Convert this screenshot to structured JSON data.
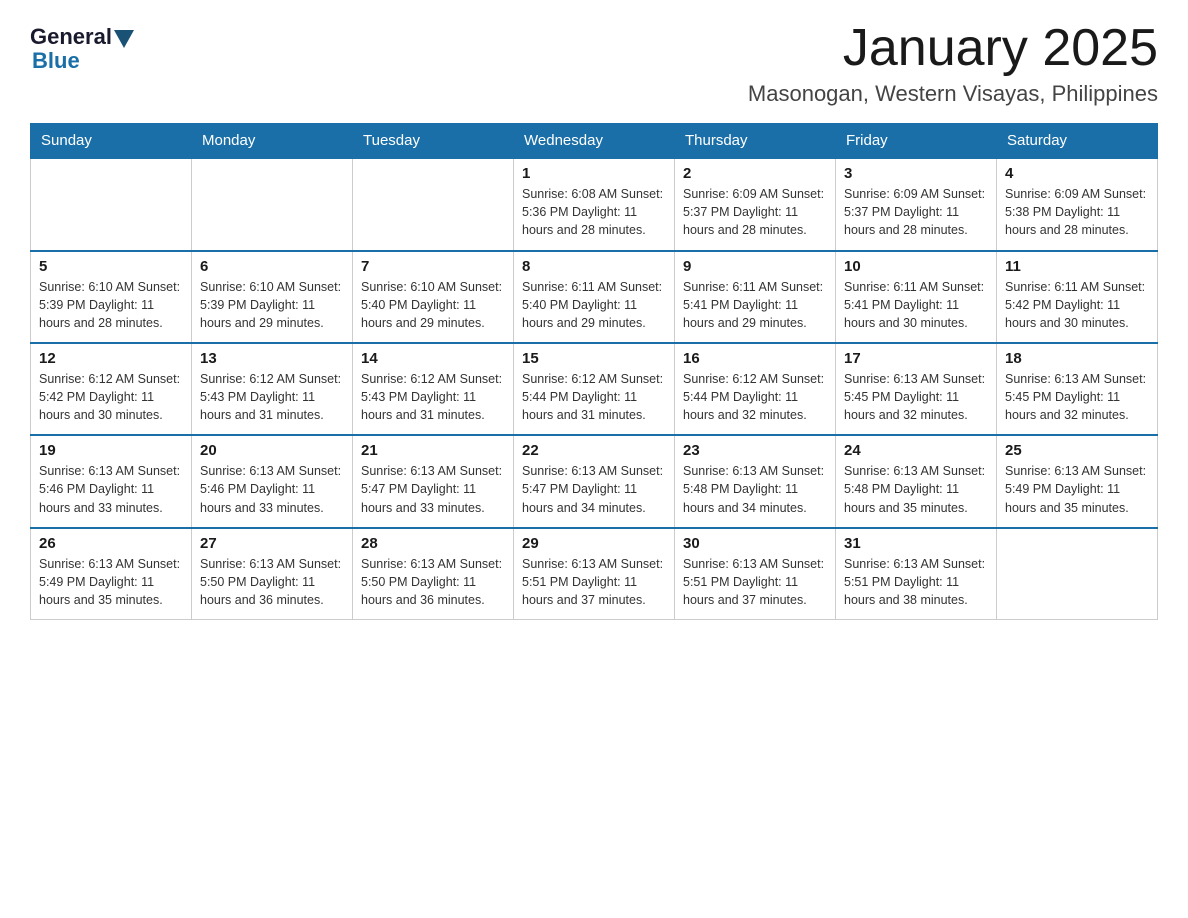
{
  "header": {
    "logo": {
      "general": "General",
      "blue": "Blue"
    },
    "title": "January 2025",
    "subtitle": "Masonogan, Western Visayas, Philippines"
  },
  "calendar": {
    "days": [
      "Sunday",
      "Monday",
      "Tuesday",
      "Wednesday",
      "Thursday",
      "Friday",
      "Saturday"
    ],
    "weeks": [
      [
        {
          "day": "",
          "info": ""
        },
        {
          "day": "",
          "info": ""
        },
        {
          "day": "",
          "info": ""
        },
        {
          "day": "1",
          "info": "Sunrise: 6:08 AM\nSunset: 5:36 PM\nDaylight: 11 hours and 28 minutes."
        },
        {
          "day": "2",
          "info": "Sunrise: 6:09 AM\nSunset: 5:37 PM\nDaylight: 11 hours and 28 minutes."
        },
        {
          "day": "3",
          "info": "Sunrise: 6:09 AM\nSunset: 5:37 PM\nDaylight: 11 hours and 28 minutes."
        },
        {
          "day": "4",
          "info": "Sunrise: 6:09 AM\nSunset: 5:38 PM\nDaylight: 11 hours and 28 minutes."
        }
      ],
      [
        {
          "day": "5",
          "info": "Sunrise: 6:10 AM\nSunset: 5:39 PM\nDaylight: 11 hours and 28 minutes."
        },
        {
          "day": "6",
          "info": "Sunrise: 6:10 AM\nSunset: 5:39 PM\nDaylight: 11 hours and 29 minutes."
        },
        {
          "day": "7",
          "info": "Sunrise: 6:10 AM\nSunset: 5:40 PM\nDaylight: 11 hours and 29 minutes."
        },
        {
          "day": "8",
          "info": "Sunrise: 6:11 AM\nSunset: 5:40 PM\nDaylight: 11 hours and 29 minutes."
        },
        {
          "day": "9",
          "info": "Sunrise: 6:11 AM\nSunset: 5:41 PM\nDaylight: 11 hours and 29 minutes."
        },
        {
          "day": "10",
          "info": "Sunrise: 6:11 AM\nSunset: 5:41 PM\nDaylight: 11 hours and 30 minutes."
        },
        {
          "day": "11",
          "info": "Sunrise: 6:11 AM\nSunset: 5:42 PM\nDaylight: 11 hours and 30 minutes."
        }
      ],
      [
        {
          "day": "12",
          "info": "Sunrise: 6:12 AM\nSunset: 5:42 PM\nDaylight: 11 hours and 30 minutes."
        },
        {
          "day": "13",
          "info": "Sunrise: 6:12 AM\nSunset: 5:43 PM\nDaylight: 11 hours and 31 minutes."
        },
        {
          "day": "14",
          "info": "Sunrise: 6:12 AM\nSunset: 5:43 PM\nDaylight: 11 hours and 31 minutes."
        },
        {
          "day": "15",
          "info": "Sunrise: 6:12 AM\nSunset: 5:44 PM\nDaylight: 11 hours and 31 minutes."
        },
        {
          "day": "16",
          "info": "Sunrise: 6:12 AM\nSunset: 5:44 PM\nDaylight: 11 hours and 32 minutes."
        },
        {
          "day": "17",
          "info": "Sunrise: 6:13 AM\nSunset: 5:45 PM\nDaylight: 11 hours and 32 minutes."
        },
        {
          "day": "18",
          "info": "Sunrise: 6:13 AM\nSunset: 5:45 PM\nDaylight: 11 hours and 32 minutes."
        }
      ],
      [
        {
          "day": "19",
          "info": "Sunrise: 6:13 AM\nSunset: 5:46 PM\nDaylight: 11 hours and 33 minutes."
        },
        {
          "day": "20",
          "info": "Sunrise: 6:13 AM\nSunset: 5:46 PM\nDaylight: 11 hours and 33 minutes."
        },
        {
          "day": "21",
          "info": "Sunrise: 6:13 AM\nSunset: 5:47 PM\nDaylight: 11 hours and 33 minutes."
        },
        {
          "day": "22",
          "info": "Sunrise: 6:13 AM\nSunset: 5:47 PM\nDaylight: 11 hours and 34 minutes."
        },
        {
          "day": "23",
          "info": "Sunrise: 6:13 AM\nSunset: 5:48 PM\nDaylight: 11 hours and 34 minutes."
        },
        {
          "day": "24",
          "info": "Sunrise: 6:13 AM\nSunset: 5:48 PM\nDaylight: 11 hours and 35 minutes."
        },
        {
          "day": "25",
          "info": "Sunrise: 6:13 AM\nSunset: 5:49 PM\nDaylight: 11 hours and 35 minutes."
        }
      ],
      [
        {
          "day": "26",
          "info": "Sunrise: 6:13 AM\nSunset: 5:49 PM\nDaylight: 11 hours and 35 minutes."
        },
        {
          "day": "27",
          "info": "Sunrise: 6:13 AM\nSunset: 5:50 PM\nDaylight: 11 hours and 36 minutes."
        },
        {
          "day": "28",
          "info": "Sunrise: 6:13 AM\nSunset: 5:50 PM\nDaylight: 11 hours and 36 minutes."
        },
        {
          "day": "29",
          "info": "Sunrise: 6:13 AM\nSunset: 5:51 PM\nDaylight: 11 hours and 37 minutes."
        },
        {
          "day": "30",
          "info": "Sunrise: 6:13 AM\nSunset: 5:51 PM\nDaylight: 11 hours and 37 minutes."
        },
        {
          "day": "31",
          "info": "Sunrise: 6:13 AM\nSunset: 5:51 PM\nDaylight: 11 hours and 38 minutes."
        },
        {
          "day": "",
          "info": ""
        }
      ]
    ]
  }
}
